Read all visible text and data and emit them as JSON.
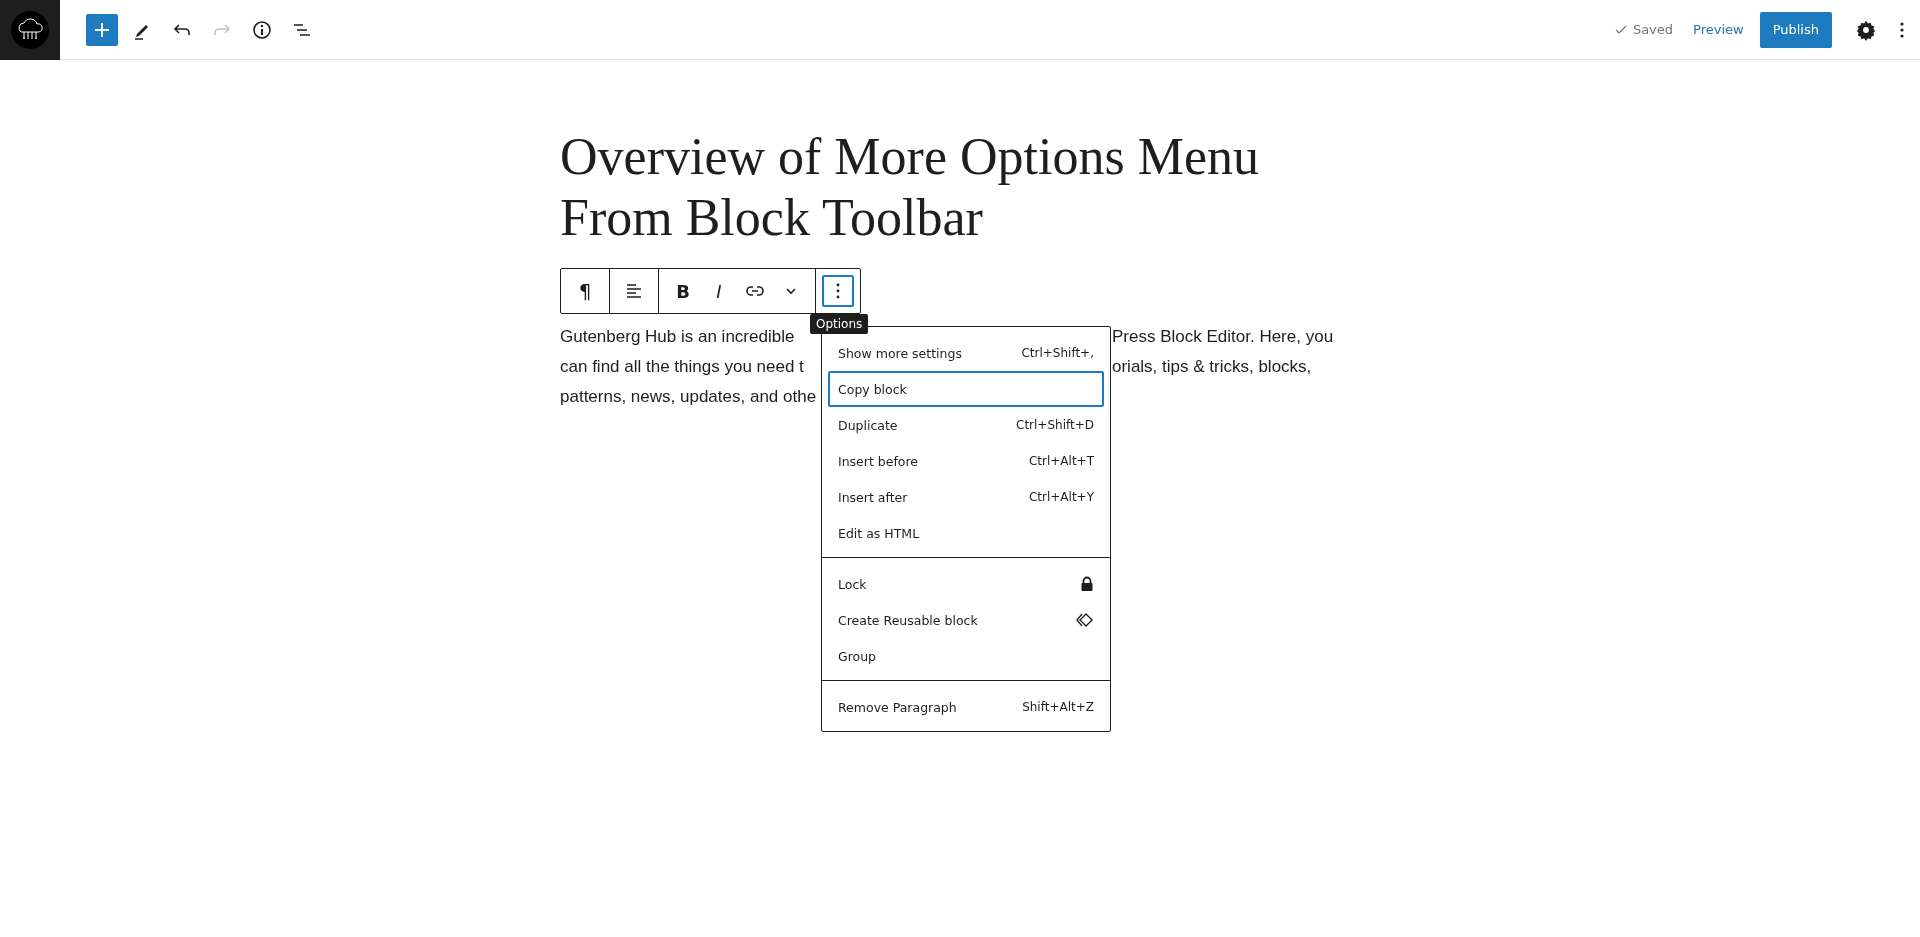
{
  "top_bar": {
    "tools": [
      {
        "kind": "add",
        "selected": true,
        "disabled": false
      },
      {
        "kind": "edit",
        "selected": false,
        "disabled": false
      },
      {
        "kind": "undo",
        "selected": false,
        "disabled": false
      },
      {
        "kind": "redo",
        "selected": false,
        "disabled": true
      },
      {
        "kind": "info",
        "selected": false,
        "disabled": false
      },
      {
        "kind": "list",
        "selected": false,
        "disabled": false
      }
    ],
    "status": "Saved",
    "preview": "Preview",
    "publish": "Publish"
  },
  "title_lines": [
    "Overview of More Options Menu",
    "From Block Toolbar"
  ],
  "block_toolbar": [
    {
      "group": [
        {
          "kind": "glyph",
          "glyph": "¶",
          "selected": false
        }
      ]
    },
    {
      "group": [
        {
          "kind": "align",
          "selected": false
        }
      ]
    },
    {
      "group": [
        {
          "kind": "bold",
          "glyph": "B",
          "selected": false
        },
        {
          "kind": "italic",
          "glyph": "I",
          "selected": false
        },
        {
          "kind": "link",
          "selected": false
        },
        {
          "kind": "more",
          "selected": false
        }
      ]
    },
    {
      "group": [
        {
          "kind": "options",
          "selected": true
        }
      ]
    }
  ],
  "tooltip": "Options",
  "paragraph_lines": [
    {
      "left": "Gutenberg Hub is an incredible",
      "right": "Press Block Editor. Here, you"
    },
    {
      "left": "can find all the things you need t",
      "right": "orials, tips & tricks, blocks,"
    },
    {
      "left": "patterns, news, updates, and othe"
    }
  ],
  "menu": [
    [
      {
        "label": "Show more settings",
        "shortcut": "Ctrl+Shift+,",
        "selected": false
      },
      {
        "label": "Copy block",
        "selected": true
      },
      {
        "label": "Duplicate",
        "shortcut": "Ctrl+Shift+D",
        "selected": false
      },
      {
        "label": "Insert before",
        "shortcut": "Ctrl+Alt+T",
        "selected": false
      },
      {
        "label": "Insert after",
        "shortcut": "Ctrl+Alt+Y",
        "selected": false
      },
      {
        "label": "Edit as HTML",
        "selected": false
      }
    ],
    [
      {
        "label": "Lock",
        "kind": "lock",
        "selected": false
      },
      {
        "label": "Create Reusable block",
        "kind": "reusable",
        "selected": false
      },
      {
        "label": "Group",
        "selected": false
      }
    ],
    [
      {
        "label": "Remove Paragraph",
        "shortcut": "Shift+Alt+Z",
        "selected": false
      }
    ]
  ]
}
